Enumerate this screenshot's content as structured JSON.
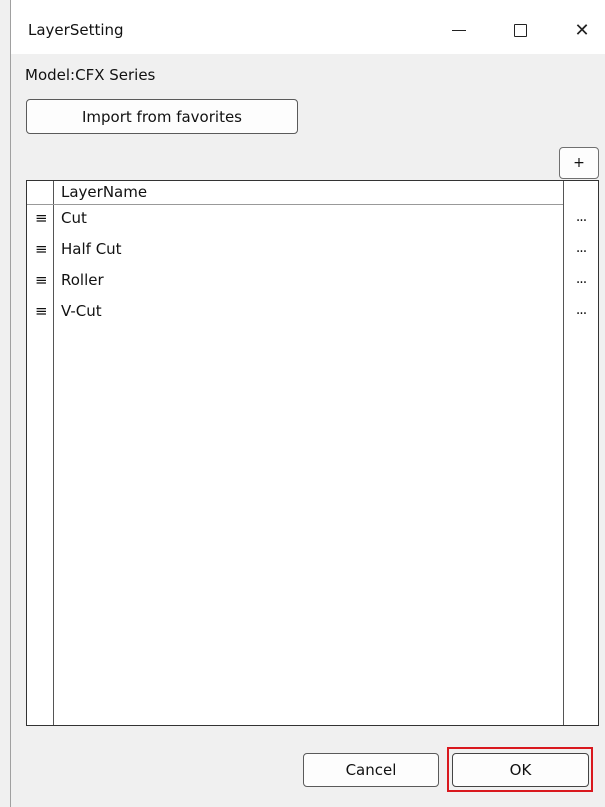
{
  "window": {
    "title": "LayerSetting",
    "minimize_icon": "minimize-icon",
    "maximize_icon": "maximize-icon",
    "close_glyph": "✕"
  },
  "model_label": "Model:CFX Series",
  "import_button": "Import from favorites",
  "add_button": "+",
  "grid": {
    "header": "LayerName",
    "handle_glyph": "≡",
    "more_glyph": "...",
    "rows": [
      {
        "name": "Cut"
      },
      {
        "name": "Half Cut"
      },
      {
        "name": "Roller"
      },
      {
        "name": "V-Cut"
      }
    ]
  },
  "footer": {
    "cancel_label": "Cancel",
    "ok_label": "OK",
    "highlight_color": "#d9181e"
  }
}
